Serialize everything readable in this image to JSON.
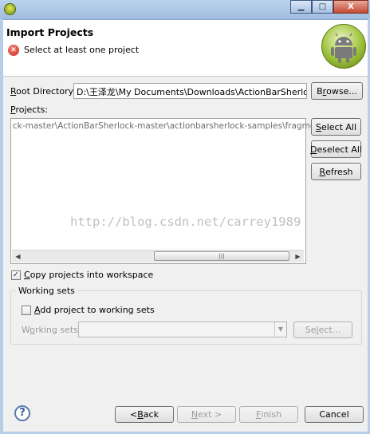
{
  "header": {
    "title": "Import Projects",
    "message": "Select at least one project"
  },
  "root": {
    "label": "Root Directory:",
    "value": "D:\\王泽龙\\My Documents\\Downloads\\ActionBarSherlock-master",
    "browse_label": "Browse..."
  },
  "projects": {
    "label": "Projects:",
    "items": [
      "ck-master\\ActionBarSherlock-master\\actionbarsherlock-samples\\fragments)"
    ],
    "select_all_label": "Select All",
    "deselect_all_label": "Deselect All",
    "refresh_label": "Refresh",
    "scroll_left": "◀",
    "scroll_right": "▶",
    "scroll_grip": "|||"
  },
  "options": {
    "copy_label": "Copy projects into workspace",
    "copy_checked": true
  },
  "working_sets": {
    "group_label": "Working sets",
    "add_label": "Add project to working sets",
    "add_checked": false,
    "field_label": "Working sets:",
    "select_label": "Select..."
  },
  "watermark": "http://blog.csdn.net/carrey1989",
  "footer": {
    "back_label": "< Back",
    "next_label": "Next >",
    "finish_label": "Finish",
    "cancel_label": "Cancel"
  },
  "window_controls": {
    "minimize": "▁",
    "maximize": "□",
    "close": "X"
  },
  "help_glyph": "?",
  "error_glyph": "✕",
  "check_glyph": "✓",
  "dropdown_glyph": "▼"
}
